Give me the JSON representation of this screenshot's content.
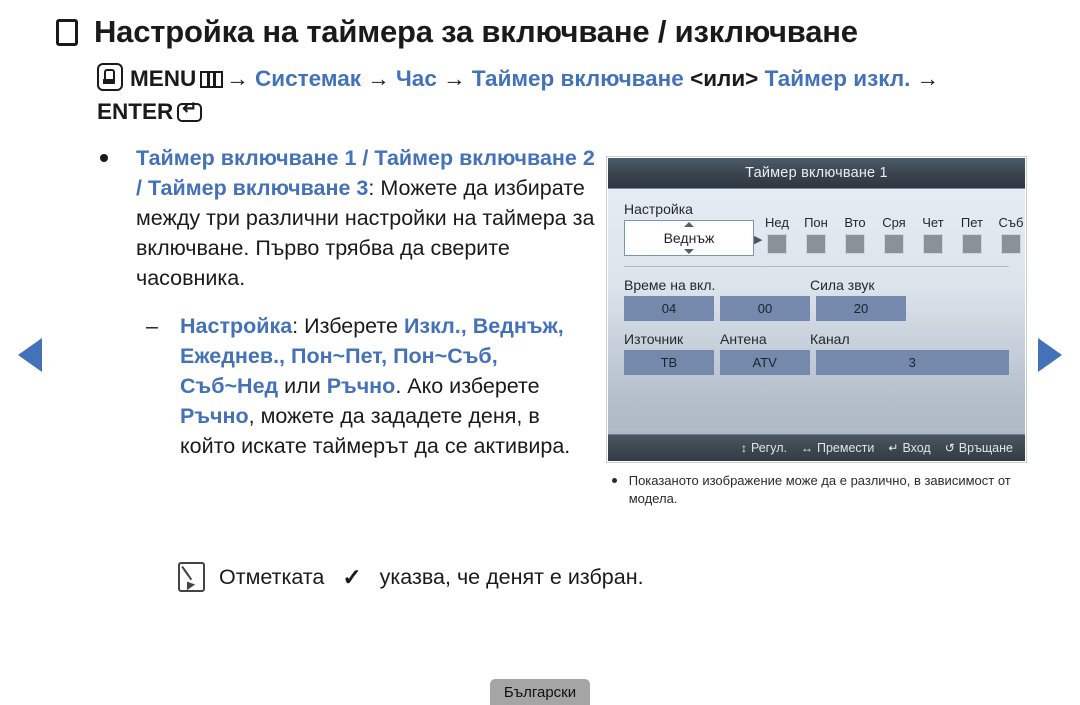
{
  "colors": {
    "accent_blue": "#4472b8",
    "text_black": "#1a1a1a",
    "osd_field_blue": "#7489ac",
    "osd_titlebar": "#39434f",
    "lang_tab_gray": "#a5a5a5"
  },
  "title": {
    "bullet_icon": "square-bullet-icon",
    "text": "Настройка на таймера за включване / изключване"
  },
  "menu_path": {
    "remote_icon": "remote-hand-icon",
    "menu_label": "MENU",
    "menu_icon": "menu-grid-icon",
    "arrow": "→",
    "step1": "Системак",
    "step2": "Час",
    "step3": "Таймер включване",
    "or_text": "<или>",
    "step4_a": "Таймер",
    "step4_b": "изкл.",
    "enter_label": "ENTER",
    "enter_icon": "enter-key-icon"
  },
  "body": {
    "bullet_icon": "round-bullet-icon",
    "item1": {
      "accent_a": "Таймер включване 1 / Таймер включване 2 / Таймер включване 3",
      "rest": ": Можете да избирате между три различни настройки на таймера за включване. Първо трябва да сверите часовника."
    },
    "item2": {
      "dash": "–",
      "a_label": "Настройка",
      "a_sep": ": ",
      "b_plain1": "Изберете ",
      "b_opts": "Изкл., Веднъж, Ежеднев., Пон~Пет, Пон~Съб, Съб~Нед",
      "b_plain2": " или ",
      "b_manual1": "Ръчно",
      "b_plain3": ". Ако изберете ",
      "b_manual2": "Ръчно",
      "b_tail": ", можете да зададете деня, в който искате таймерът да се активира."
    }
  },
  "note": {
    "pencil_icon": "note-pencil-icon",
    "text_before": "Отметката",
    "check_icon": "✓",
    "text_after": "указва, че денят е избран."
  },
  "nav": {
    "prev_icon": "triangle-left-icon",
    "next_icon": "triangle-right-icon"
  },
  "tv_panel": {
    "title": "Таймер включване 1",
    "setting_label": "Настройка",
    "setting_value": "Веднъж",
    "setting_caret_icon": "caret-right-icon",
    "spin_up_icon": "caret-up-icon",
    "spin_down_icon": "caret-down-icon",
    "days": [
      {
        "name": "Нед",
        "checked": false
      },
      {
        "name": "Пон",
        "checked": false
      },
      {
        "name": "Вто",
        "checked": false
      },
      {
        "name": "Сря",
        "checked": false
      },
      {
        "name": "Чет",
        "checked": false
      },
      {
        "name": "Пет",
        "checked": false
      },
      {
        "name": "Съб",
        "checked": false
      }
    ],
    "time_label": "Време на вкл.",
    "volume_label": "Сила звук",
    "time_hour": "04",
    "time_minute": "00",
    "volume_value": "20",
    "source_label": "Източник",
    "antenna_label": "Антена",
    "channel_label": "Канал",
    "source_value": "ТВ",
    "antenna_value": "ATV",
    "channel_value": "3",
    "footer": [
      {
        "icon": "updown-arrows-icon",
        "glyph": "↕",
        "label": "Регул."
      },
      {
        "icon": "leftright-arrows-icon",
        "glyph": "↔",
        "label": "Премести"
      },
      {
        "icon": "enter-key-icon",
        "glyph": "↵",
        "label": "Вход"
      },
      {
        "icon": "return-arrow-icon",
        "glyph": "↺",
        "label": "Връщане"
      }
    ]
  },
  "tv_note": {
    "bullet_icon": "round-bullet-icon",
    "text": "Показаното изображение може да е различно, в зависимост от модела."
  },
  "language_tab": {
    "label": "Български"
  }
}
